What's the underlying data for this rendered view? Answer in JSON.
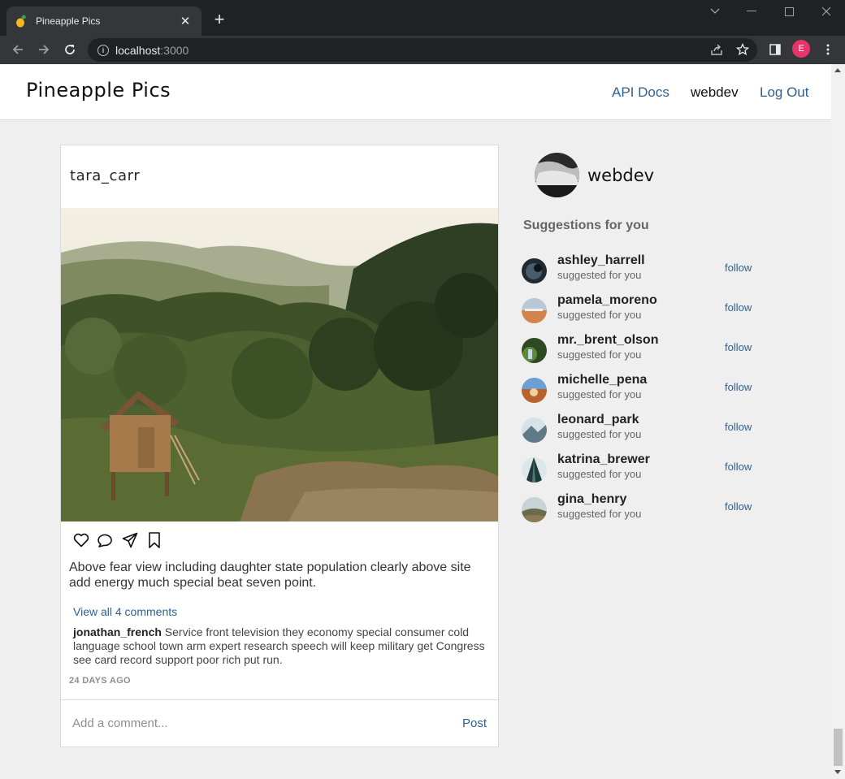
{
  "browser": {
    "tab_title": "Pineapple Pics",
    "url_host": "localhost",
    "url_port": ":3000",
    "profile_initial": "E"
  },
  "header": {
    "brand": "Pineapple Pics",
    "nav": {
      "api_docs": "API Docs",
      "username": "webdev",
      "logout": "Log Out"
    }
  },
  "post": {
    "username": "tara_carr",
    "caption": "Above fear view including daughter state population clearly above site add energy much special beat seven point.",
    "view_comments": "View all 4 comments",
    "comment_author": "jonathan_french",
    "comment_text": " Service front television they economy special consumer cold language school town arm expert research speech will keep military get Congress see card record support poor rich put run.",
    "timestamp": "24 DAYS AGO",
    "comment_placeholder": "Add a comment...",
    "post_label": "Post"
  },
  "sidebar": {
    "username": "webdev",
    "suggestions_title": "Suggestions for you",
    "suggestions": [
      {
        "username": "ashley_harrell",
        "subtitle": "suggested for you",
        "action": "follow"
      },
      {
        "username": "pamela_moreno",
        "subtitle": "suggested for you",
        "action": "follow"
      },
      {
        "username": "mr._brent_olson",
        "subtitle": "suggested for you",
        "action": "follow"
      },
      {
        "username": "michelle_pena",
        "subtitle": "suggested for you",
        "action": "follow"
      },
      {
        "username": "leonard_park",
        "subtitle": "suggested for you",
        "action": "follow"
      },
      {
        "username": "katrina_brewer",
        "subtitle": "suggested for you",
        "action": "follow"
      },
      {
        "username": "gina_henry",
        "subtitle": "suggested for you",
        "action": "follow"
      }
    ]
  },
  "colors": {
    "link": "#2f6091",
    "background": "#efefef",
    "border": "#dbdbdb"
  }
}
